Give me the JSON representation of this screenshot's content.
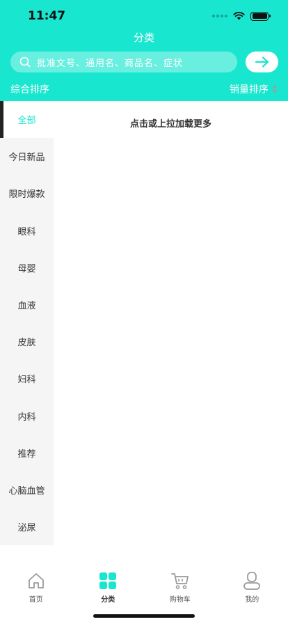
{
  "status_bar": {
    "time": "11:47"
  },
  "header": {
    "title": "分类"
  },
  "search": {
    "placeholder": "批准文号、通用名、商品名、症状"
  },
  "sort": {
    "left_label": "综合排序",
    "right_label": "销量排序"
  },
  "sidebar": {
    "items": [
      {
        "label": "全部",
        "active": true
      },
      {
        "label": "今日新品"
      },
      {
        "label": "限时爆款"
      },
      {
        "label": "眼科"
      },
      {
        "label": "母婴"
      },
      {
        "label": "血液"
      },
      {
        "label": "皮肤"
      },
      {
        "label": "妇科"
      },
      {
        "label": "内科"
      },
      {
        "label": "推荐"
      },
      {
        "label": "心脑血管"
      },
      {
        "label": "泌尿"
      }
    ]
  },
  "content": {
    "load_more": "点击或上拉加载更多"
  },
  "tab_bar": {
    "tabs": [
      {
        "label": "首页",
        "icon": "home-icon"
      },
      {
        "label": "分类",
        "icon": "category-icon",
        "active": true
      },
      {
        "label": "购物车",
        "icon": "cart-icon"
      },
      {
        "label": "我的",
        "icon": "profile-icon"
      }
    ]
  },
  "colors": {
    "accent": "#19e6cf",
    "sidebar_bg": "#f5f5f5",
    "text": "#333333"
  }
}
